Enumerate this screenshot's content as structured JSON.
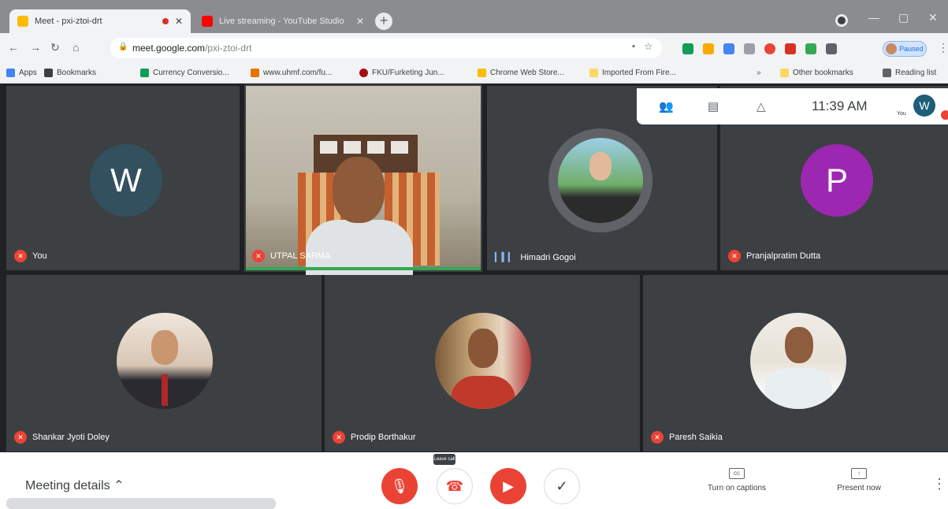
{
  "browser": {
    "tabs": [
      {
        "title": "Meet - pxi-ztoi-drt",
        "favicon_color": "#fbbc04"
      },
      {
        "title": "Live streaming - YouTube Studio",
        "favicon_color": "#ff0000"
      }
    ],
    "url_host": "meet.google.com",
    "url_path": "/pxi-ztoi-drt",
    "profile_status": "Paused",
    "bookmarks": [
      "Apps",
      "Bookmarks",
      "Currency Conversio...",
      "www.uhmf.com/fu...",
      "FKU/Furketing Jun...",
      "Chrome Web Store...",
      "Imported From Fire...",
      "Other bookmarks",
      "Reading list"
    ]
  },
  "meet": {
    "time": "11:39 AM",
    "self_initial": "W",
    "self_label": "You",
    "participants": [
      {
        "name": "You",
        "initial": "W",
        "avatar_color": "#33505f",
        "muted": true
      },
      {
        "name": "UTPAL SARMA",
        "muted": true,
        "video": true
      },
      {
        "name": "Himadri Gogoi",
        "speaking": true
      },
      {
        "name": "Pranjalpratim Dutta",
        "initial": "P",
        "avatar_color": "#9c27b0",
        "muted": true
      },
      {
        "name": "Shankar Jyoti Doley",
        "muted": true
      },
      {
        "name": "Prodip Borthakur",
        "muted": true
      },
      {
        "name": "Paresh Saikia",
        "muted": true
      }
    ],
    "bottom": {
      "details_label": "Meeting details",
      "leave_tooltip": "Leave call",
      "captions_label": "Turn on captions",
      "present_label": "Present now"
    }
  }
}
